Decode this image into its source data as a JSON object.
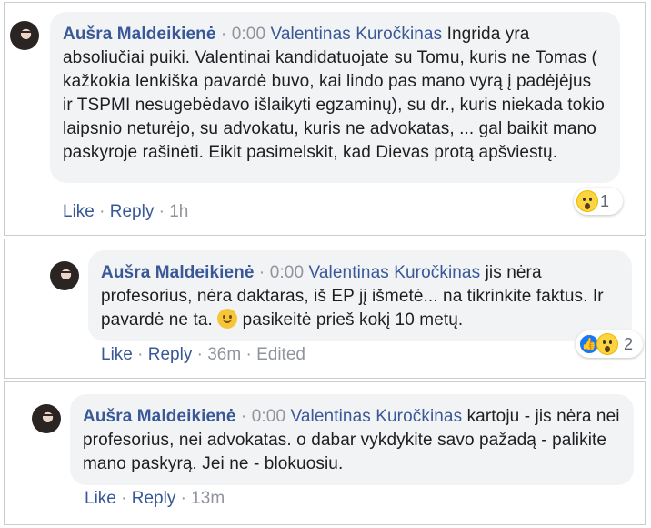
{
  "comments": [
    {
      "author": "Aušra Maldeikienė",
      "separator": " · ",
      "timestamp": "0:00",
      "mention": "Valentinas Kuročkinas",
      "text": " Ingrida yra absoliučiai puiki. Valentinai kandidatuojate su Tomu, kuris ne Tomas ( kažkokia lenkiška pavardė buvo, kai lindo pas mano vyrą į padėjėjus ir TSPMI nesugebėdavo išlaikyti egzaminų), su dr., kuris niekada tokio laipsnio neturėjo, su advokatu, kuris ne advokatas, ... gal baikit mano paskyroje rašinėti. Eikit pasimelskit, kad Dievas protą apšviestų.",
      "reactions": {
        "icons": [
          "wow-icon"
        ],
        "count": "1"
      },
      "actions": {
        "like": "Like",
        "reply": "Reply",
        "dot": " · ",
        "age": "1h",
        "edited": ""
      }
    },
    {
      "author": "Aušra Maldeikienė",
      "separator": " · ",
      "timestamp": "0:00",
      "mention": "Valentinas Kuročkinas",
      "text": " jis nėra profesorius, nėra daktaras, iš EP jį išmetė... na tikrinkite faktus. Ir pavardė ne ta.",
      "text_after_emoji": " pasikeitė prieš kokį 10 metų.",
      "emoji": "smiley-icon",
      "reactions": {
        "icons": [
          "like-icon",
          "wow-icon"
        ],
        "count": "2"
      },
      "actions": {
        "like": "Like",
        "reply": "Reply",
        "dot": " · ",
        "age": "36m",
        "edited": "Edited"
      }
    },
    {
      "author": "Aušra Maldeikienė",
      "separator": " · ",
      "timestamp": "0:00",
      "mention": "Valentinas Kuročkinas",
      "text": " kartoju - jis nėra nei profesorius, nei advokatas. o dabar vykdykite savo pažadą - palikite mano paskyrą. Jei ne - blokuosiu.",
      "actions": {
        "like": "Like",
        "reply": "Reply",
        "dot": " · ",
        "age": "13m",
        "edited": ""
      }
    }
  ],
  "colors": {
    "link": "#385898",
    "meta": "#90949c",
    "bubble": "#f2f3f5"
  }
}
